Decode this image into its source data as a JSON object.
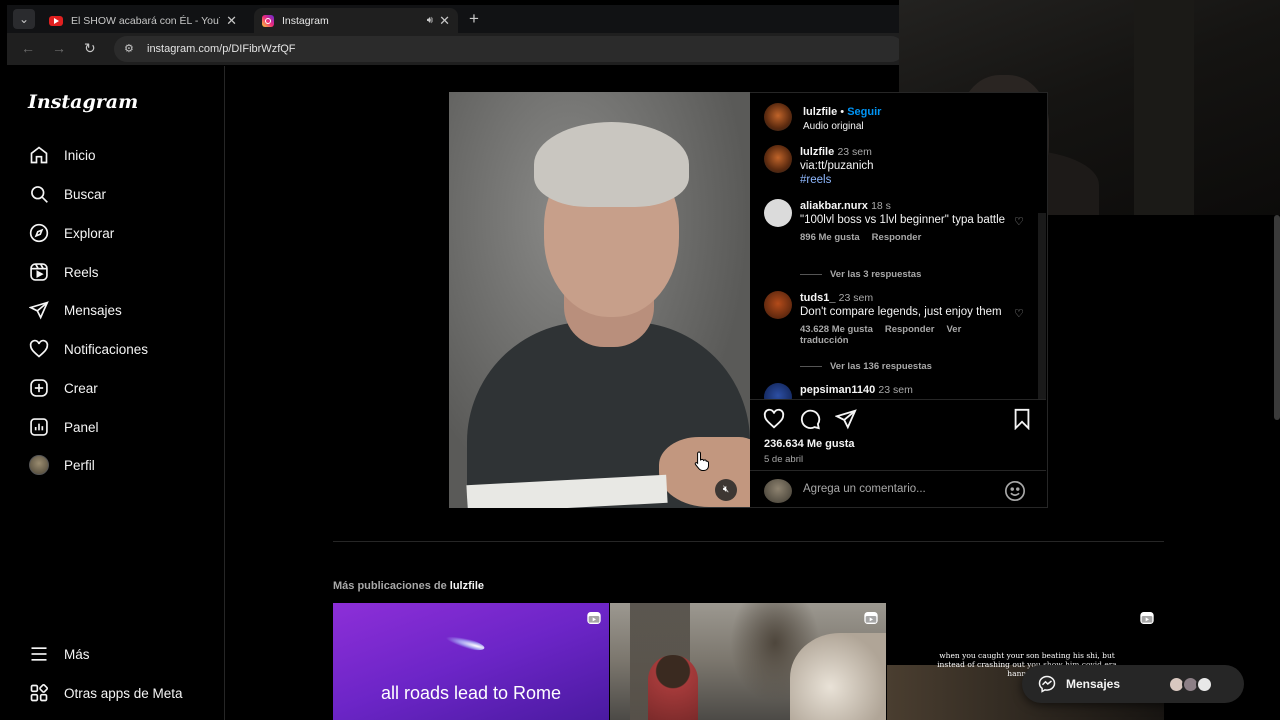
{
  "browser": {
    "tabs": [
      {
        "title": "El SHOW acabará con ÉL - YouTube",
        "active": false
      },
      {
        "title": "Instagram",
        "active": true
      }
    ],
    "url": "instagram.com/p/DIFibrWzfQF"
  },
  "sidebar": {
    "logo": "Instagram",
    "items": [
      {
        "label": "Inicio",
        "icon": "home-icon"
      },
      {
        "label": "Buscar",
        "icon": "search-icon"
      },
      {
        "label": "Explorar",
        "icon": "compass-icon"
      },
      {
        "label": "Reels",
        "icon": "reels-icon"
      },
      {
        "label": "Mensajes",
        "icon": "send-icon"
      },
      {
        "label": "Notificaciones",
        "icon": "heart-icon"
      },
      {
        "label": "Crear",
        "icon": "plus-square-icon"
      },
      {
        "label": "Panel",
        "icon": "dashboard-icon"
      },
      {
        "label": "Perfil",
        "icon": "avatar"
      }
    ],
    "bottom": [
      {
        "label": "Más",
        "icon": "menu-icon"
      },
      {
        "label": "Otras apps de Meta",
        "icon": "meta-apps-icon"
      }
    ]
  },
  "post": {
    "author": "lulzfile",
    "separator": " • ",
    "follow": "Seguir",
    "audio": "Audio original",
    "caption": {
      "user": "lulzfile",
      "time": "23 sem",
      "line1": "via:tt/puzanich",
      "hashtag": "#reels"
    },
    "comments": [
      {
        "user": "aliakbar.nurx",
        "time": "18 s",
        "text": "\"100lvl boss vs 1lvl beginner\" typa battle",
        "likes": "896 Me gusta",
        "reply": "Responder",
        "translate": "",
        "replies": "Ver las 3 respuestas"
      },
      {
        "user": "tuds1_",
        "time": "23 sem",
        "text": "Don't compare legends, just enjoy them",
        "likes": "43.628 Me gusta",
        "reply": "Responder",
        "translate": "Ver traducción",
        "replies": "Ver las 136 respuestas"
      },
      {
        "user": "pepsiman1140",
        "time": "23 sem",
        "text": ""
      }
    ],
    "likes": "236.634 Me gusta",
    "date": "5 de abril",
    "comment_placeholder": "Agrega un comentario..."
  },
  "more_posts": {
    "label_prefix": "Más publicaciones de ",
    "label_user": "lulzfile",
    "thumbs": [
      {
        "text": "all roads lead to Rome"
      },
      {
        "text": ""
      },
      {
        "text": "when you caught your son beating his shi, but instead of crashing out you show him covid era hannah ov"
      }
    ]
  },
  "messages": {
    "label": "Mensajes"
  },
  "colors": {
    "accent": "#0095f6",
    "bg": "#000000",
    "border": "#262626",
    "muted": "#a8a8a8"
  }
}
